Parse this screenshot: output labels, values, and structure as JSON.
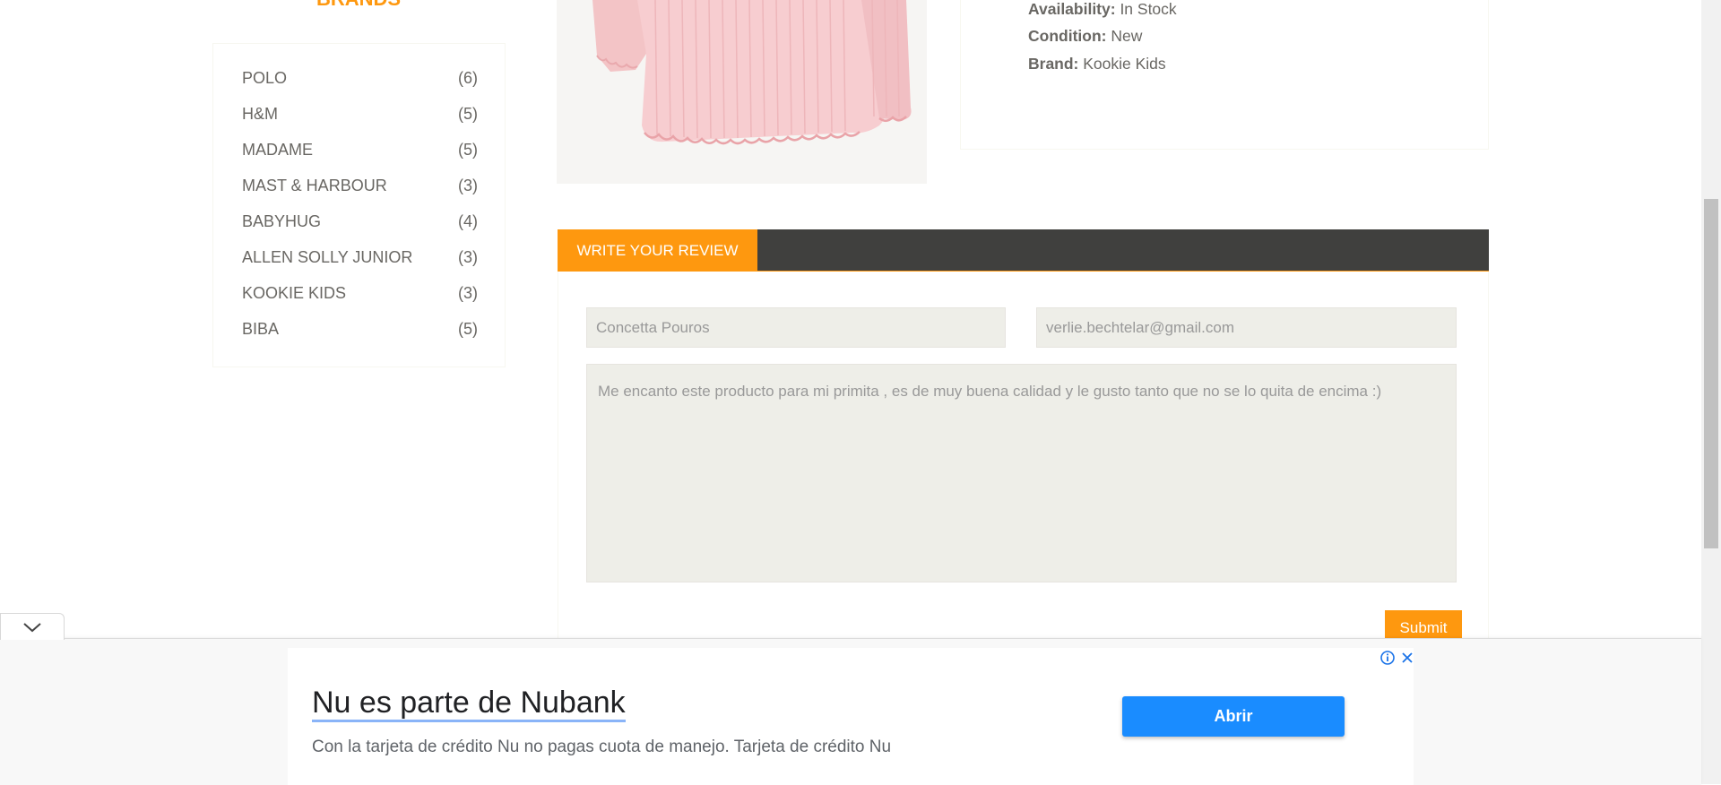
{
  "sidebar": {
    "heading": "BRANDS",
    "brands": [
      {
        "name": "POLO",
        "count": "(6)"
      },
      {
        "name": "H&M",
        "count": "(5)"
      },
      {
        "name": "MADAME",
        "count": "(5)"
      },
      {
        "name": "MAST & HARBOUR",
        "count": "(3)"
      },
      {
        "name": "BABYHUG",
        "count": "(4)"
      },
      {
        "name": "ALLEN SOLLY JUNIOR",
        "count": "(3)"
      },
      {
        "name": "KOOKIE KIDS",
        "count": "(3)"
      },
      {
        "name": "BIBA",
        "count": "(5)"
      }
    ]
  },
  "product": {
    "availability_label": "Availability:",
    "availability_value": " In Stock",
    "condition_label": "Condition:",
    "condition_value": " New",
    "brand_label": "Brand:",
    "brand_value": " Kookie Kids"
  },
  "review": {
    "tab_label": "WRITE YOUR REVIEW",
    "name_value": "Concetta Pouros",
    "email_value": "verlie.bechtelar@gmail.com",
    "review_text": "Me encanto este producto para mi primita , es de muy buena calidad y le gusto tanto que no se lo quita de encima :)",
    "submit_label": "Submit"
  },
  "ad": {
    "title": "Nu es parte de Nubank",
    "description": "Con la tarjeta de crédito Nu no pagas cuota de manejo. Tarjeta de crédito Nu",
    "button_label": "Abrir"
  },
  "colors": {
    "accent": "#FE980F",
    "tab_bar": "#40403E",
    "field_bg": "#eeeee8",
    "ad_button": "#1a8cff"
  }
}
